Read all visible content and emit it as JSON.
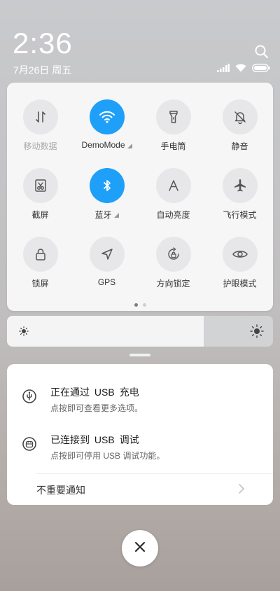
{
  "status": {
    "time": "2:36",
    "date": "7月26日 周五"
  },
  "quick_settings": {
    "tiles": [
      {
        "label": "移动数据",
        "icon": "mobile-data-icon",
        "active": false,
        "disabled": true,
        "signal_marker": false
      },
      {
        "label": "DemoMode",
        "icon": "wifi-icon",
        "active": true,
        "disabled": false,
        "signal_marker": true
      },
      {
        "label": "手电筒",
        "icon": "flashlight-icon",
        "active": false,
        "disabled": false,
        "signal_marker": false
      },
      {
        "label": "静音",
        "icon": "mute-bell-icon",
        "active": false,
        "disabled": false,
        "signal_marker": false
      },
      {
        "label": "截屏",
        "icon": "screenshot-icon",
        "active": false,
        "disabled": false,
        "signal_marker": false
      },
      {
        "label": "蓝牙",
        "icon": "bluetooth-icon",
        "active": true,
        "disabled": false,
        "signal_marker": true
      },
      {
        "label": "自动亮度",
        "icon": "auto-brightness-icon",
        "active": false,
        "disabled": false,
        "signal_marker": false
      },
      {
        "label": "飞行模式",
        "icon": "airplane-icon",
        "active": false,
        "disabled": false,
        "signal_marker": false
      },
      {
        "label": "锁屏",
        "icon": "lock-icon",
        "active": false,
        "disabled": false,
        "signal_marker": false
      },
      {
        "label": "GPS",
        "icon": "location-arrow-icon",
        "active": false,
        "disabled": false,
        "signal_marker": false
      },
      {
        "label": "方向锁定",
        "icon": "rotation-lock-icon",
        "active": false,
        "disabled": false,
        "signal_marker": false
      },
      {
        "label": "护眼模式",
        "icon": "eye-icon",
        "active": false,
        "disabled": false,
        "signal_marker": false
      }
    ],
    "current_page": 1,
    "page_count": 2
  },
  "brightness": {
    "level": 0.739
  },
  "notifications": [
    {
      "title": "正在通过 USB 充电",
      "subtitle": "点按即可查看更多选项。",
      "icon": "usb-icon"
    },
    {
      "title": "已连接到 USB 调试",
      "subtitle": "点按即可停用 USB 调试功能。",
      "icon": "android-debug-icon"
    }
  ],
  "unimportant": {
    "label": "不重要通知"
  },
  "colors": {
    "accent": "#1ea0f9",
    "tile_inactive": "#e7e7e9",
    "panel": "#f6f6f7"
  }
}
